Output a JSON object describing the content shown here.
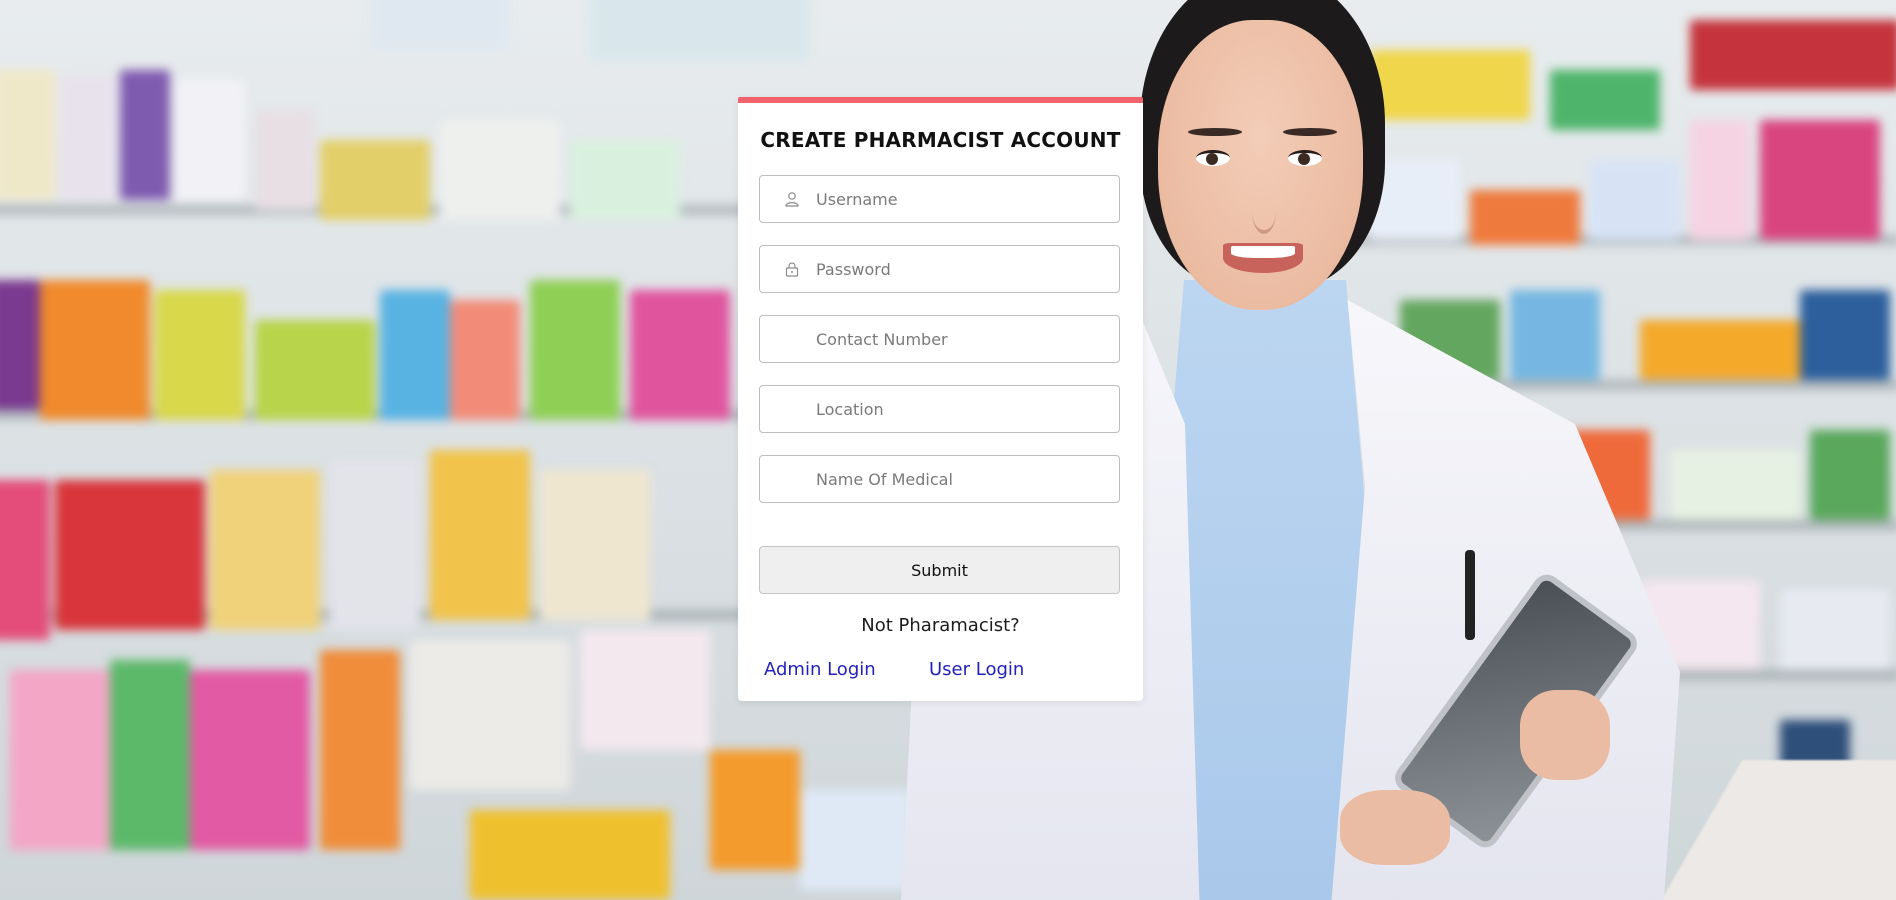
{
  "form": {
    "title": "CREATE PHARMACIST ACCOUNT",
    "fields": [
      {
        "placeholder": "Username",
        "icon": "user-icon"
      },
      {
        "placeholder": "Password",
        "icon": "lock-icon"
      },
      {
        "placeholder": "Contact Number"
      },
      {
        "placeholder": "Location"
      },
      {
        "placeholder": "Name Of Medical"
      }
    ],
    "submit_label": "Submit",
    "prompt": "Not Pharamacist?",
    "links": {
      "admin_login": "Admin Login",
      "user_login": "User Login"
    }
  },
  "colors": {
    "accent_top_border": "#f0636b",
    "link": "#2222bb",
    "card_background": "#ffffff"
  }
}
